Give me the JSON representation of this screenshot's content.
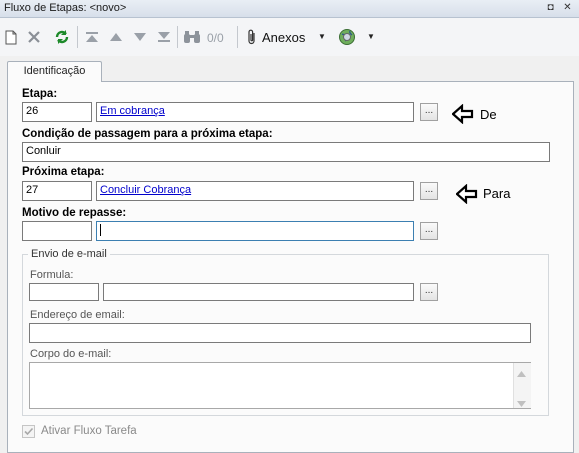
{
  "window": {
    "title": "Fluxo de Etapas: <novo>",
    "pin_glyph": "◘",
    "close_glyph": "✕"
  },
  "toolbar": {
    "record_counter": "0/0",
    "anexos_label": "Anexos",
    "dropdown_glyph": "▼"
  },
  "tabs": [
    {
      "label": "Identificação"
    }
  ],
  "form": {
    "etapa": {
      "label": "Etapa:",
      "code": "26",
      "description": "Em cobrança ",
      "button": "..."
    },
    "condicao": {
      "label": "Condição de passagem para a próxima etapa:",
      "value": "Conluir"
    },
    "proxima_etapa": {
      "label": "Próxima etapa:",
      "code": "27",
      "description": "Concluir Cobrança",
      "button": "..."
    },
    "motivo": {
      "label": "Motivo de repasse:",
      "code": "",
      "description": "",
      "button": "..."
    },
    "email_group": {
      "legend": "Envio de e-mail",
      "formula_label": "Formula:",
      "formula_code": "",
      "formula_desc": "",
      "formula_button": "...",
      "endereco_label": "Endereço de email:",
      "endereco_value": "",
      "corpo_label": "Corpo do e-mail:",
      "corpo_value": ""
    },
    "ativar": {
      "label": "Ativar Fluxo Tarefa",
      "checked": true
    }
  },
  "annotations": {
    "de": "De",
    "para": "Para"
  }
}
